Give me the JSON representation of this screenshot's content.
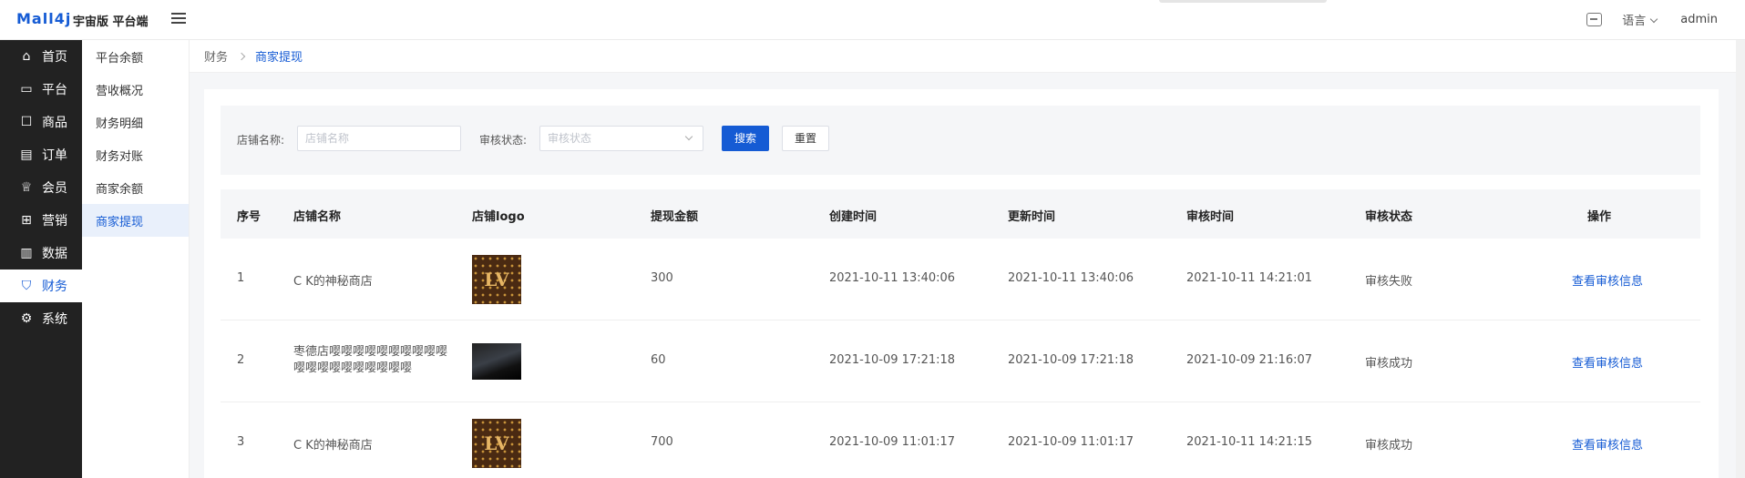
{
  "header": {
    "logo": "Mall4j",
    "brand": "宇宙版 平台端",
    "language": "语言",
    "user": "admin"
  },
  "sidebar": {
    "items": [
      {
        "label": "首页",
        "icon": "home-icon"
      },
      {
        "label": "平台",
        "icon": "monitor-icon"
      },
      {
        "label": "商品",
        "icon": "box-icon"
      },
      {
        "label": "订单",
        "icon": "document-icon"
      },
      {
        "label": "会员",
        "icon": "crown-icon"
      },
      {
        "label": "营销",
        "icon": "gift-icon"
      },
      {
        "label": "数据",
        "icon": "bar-chart-icon"
      },
      {
        "label": "财务",
        "icon": "shield-icon"
      },
      {
        "label": "系统",
        "icon": "gear-icon"
      }
    ],
    "active_index": 7
  },
  "subnav": {
    "items": [
      "平台余额",
      "营收概况",
      "财务明细",
      "财务对账",
      "商家余额",
      "商家提现"
    ],
    "active_index": 5
  },
  "breadcrumb": {
    "parent": "财务",
    "current": "商家提现"
  },
  "search": {
    "shop_label": "店铺名称:",
    "shop_placeholder": "店铺名称",
    "status_label": "审核状态:",
    "status_placeholder": "审核状态",
    "search_button": "搜索",
    "reset_button": "重置"
  },
  "table": {
    "columns": [
      "序号",
      "店铺名称",
      "店铺logo",
      "提现金额",
      "创建时间",
      "更新时间",
      "审核时间",
      "审核状态",
      "操作"
    ],
    "rows": [
      {
        "index": "1",
        "shop": "C K的神秘商店",
        "logo": "lv-logo",
        "amount": "300",
        "created": "2021-10-11 13:40:06",
        "updated": "2021-10-11 13:40:06",
        "audited": "2021-10-11 14:21:01",
        "status": "审核失败",
        "action": "查看审核信息"
      },
      {
        "index": "2",
        "shop": "枣德店嘤嘤嘤嘤嘤嘤嘤嘤嘤嘤嘤嘤嘤嘤嘤嘤嘤嘤嘤嘤",
        "logo": "dark-photo",
        "amount": "60",
        "created": "2021-10-09 17:21:18",
        "updated": "2021-10-09 17:21:18",
        "audited": "2021-10-09 21:16:07",
        "status": "审核成功",
        "action": "查看审核信息"
      },
      {
        "index": "3",
        "shop": "C K的神秘商店",
        "logo": "lv-logo",
        "amount": "700",
        "created": "2021-10-09 11:01:17",
        "updated": "2021-10-09 11:01:17",
        "audited": "2021-10-11 14:21:15",
        "status": "审核成功",
        "action": "查看审核信息"
      }
    ]
  },
  "colors": {
    "accent": "#155bd4",
    "sidebar_bg": "#222222"
  }
}
